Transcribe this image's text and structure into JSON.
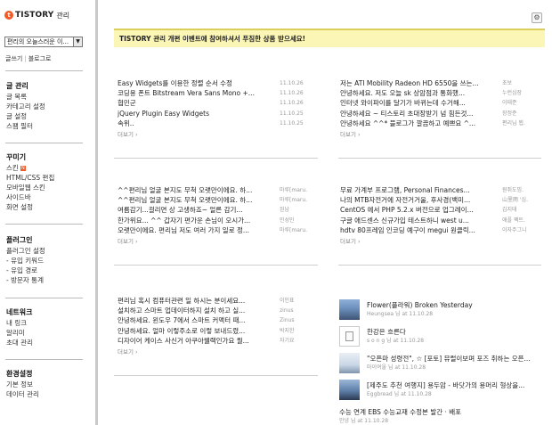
{
  "brand": {
    "logo_text": "TISTORY",
    "sub": "관리"
  },
  "blog_select": {
    "value": "편리의 오늘스러운 이..."
  },
  "sub_links": [
    "글쓰기",
    "블로그로"
  ],
  "sidebar": {
    "groups": [
      {
        "title": "글 관리",
        "items": [
          "글 목록",
          "카테고리 설정",
          "글 설정",
          "스팸 필터"
        ]
      },
      {
        "title": "꾸미기",
        "items": [
          "스킨",
          "HTML/CSS 편집",
          "모바일웹 스킨",
          "사이드바",
          "화면 설정"
        ]
      },
      {
        "title": "플러그인",
        "items": [
          "플러그인 설정",
          "- 유입 키워드",
          "- 유입 경로",
          "- 방문자 통계"
        ]
      },
      {
        "title": "네트워크",
        "items": [
          "내 링크",
          "알리미",
          "초대 관리"
        ]
      },
      {
        "title": "환경설정",
        "items": [
          "기본 정보",
          "데이터 관리"
        ]
      }
    ],
    "new_badge": "N"
  },
  "gear_label": "⚙",
  "banner": {
    "text": "TISTORY 관리 개편 이벤트에 참여하셔서 푸짐한 상품 받으세요!"
  },
  "more_label": "더보기 ›",
  "panels": {
    "posts": [
      {
        "title": "Easy Widgets를 이용한 정렬 순서 수정",
        "meta": "11.10.26"
      },
      {
        "title": "코딩용 폰트 Bitstream Vera Sans Mono +...",
        "meta": "11.10.26"
      },
      {
        "title": "협민군",
        "meta": "11.10.26"
      },
      {
        "title": "jQuery Plugin Easy Widgets",
        "meta": "11.10.25"
      },
      {
        "title": "속위..",
        "meta": "11.10.25"
      }
    ],
    "comments": [
      {
        "title": "저는 ATI Mobility Radeon HD 6550을 쓰는...",
        "meta": "초보"
      },
      {
        "title": "안녕하세요. 저도 오늘 sk 상암점과 통화했...",
        "meta": "누런심장"
      },
      {
        "title": "인터넷 와이파이를 달기가 바뀌는데 수거해...",
        "meta": "이태준"
      },
      {
        "title": "안녕하세요 ~ 티스토리 초대장받기 넘 힘든것...",
        "meta": "장정준"
      },
      {
        "title": "안녕하세요 ^^* 블로그가 깔끔하고 예쁘요 ^...",
        "meta": "편리님 뵙."
      }
    ],
    "guestbook": [
      {
        "title": "^^편리님 얼굴 본지도 무척 오랫만이에요. 하...",
        "meta": "마루[maru."
      },
      {
        "title": "^^편리님 얼굴 본지도 무척 오랫만이에요. 하...",
        "meta": "마루[maru."
      },
      {
        "title": "여름감기...걸리면 상 고생하죠~ 얼른 감기...",
        "meta": "된남"
      },
      {
        "title": "한가위요... ^^ 갑자기 편가운 손님이 오시가...",
        "meta": "민성민"
      },
      {
        "title": "오랫만이에요. 편리님 저도 여러 가지 일로 정...",
        "meta": "마루[maru."
      }
    ],
    "trackbacks": [
      {
        "title": "무료 가계부 프로그램, Personal Finances...",
        "meta": "원쥐도밈."
      },
      {
        "title": "나의 MTB자전거에 자전거거울, 후사경(백미...",
        "meta": "山里雨 '심."
      },
      {
        "title": "CentOS 에서 PHP 5.2.x 버전으로 업그레이...",
        "meta": "김지태"
      },
      {
        "title": "구글 애드센스 신규가입 테스트하니 west u...",
        "meta": "애플 팩트."
      },
      {
        "title": "hdtv 80프레임 인코딩 예구이 megui 원클릭...",
        "meta": "이자주그니"
      }
    ],
    "notices": [
      {
        "title": "편리님 혹시 컴퓨터관련 일 하시는 분이세요...",
        "meta": "이인표"
      },
      {
        "title": "설치하고 스마트 업데이터하지 설치 하고 실...",
        "meta": "zinus"
      },
      {
        "title": "안녕하세요. 윈도우 7에서 스마트 커맥터 때...",
        "meta": "Zinus"
      },
      {
        "title": "안녕하세요. 얼마 이렇주소로 이렇 보내드렸...",
        "meta": "박지한"
      },
      {
        "title": "디자이어 케이스 사신거 아쿠아웰랙인가요 뭘...",
        "meta": "자기요"
      }
    ]
  },
  "recent": [
    {
      "title": "Flower(플라워) Broken Yesterday",
      "meta": "Heungsea 님 at 11.10.28",
      "thumb": "photo1"
    },
    {
      "title": "한강은 흐른다",
      "meta": "s o n g 님 at 11.10.28",
      "thumb": "empty"
    },
    {
      "title": "\"오픈마 성령전\", ☆ [포토] 뮤럴이보며 포즈 취하는 오픈...",
      "meta": "마이여울 님 at 11.10.28",
      "thumb": "none"
    },
    {
      "title": "[제주도 추천 여행지] 용두암 - 바닷가의 용머리 형상을...",
      "meta": "Eggbread 님 at 11.10.28",
      "thumb": "photo3"
    },
    {
      "title": "수능 연계 EBS 수능교재 수정본 발간 · 배포",
      "meta": "안녕 님 at 11.10.28",
      "thumb": "none"
    }
  ]
}
